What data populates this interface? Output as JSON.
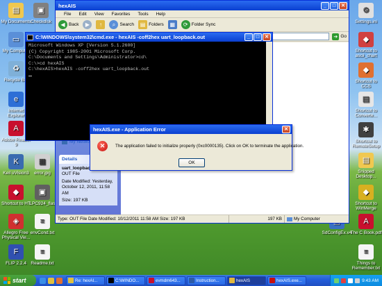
{
  "desktop_icons": {
    "my_documents": "My Documents",
    "checkdisk": "Checkdisk",
    "my_computer": "My Computer",
    "recycle_bin": "Recycle Bin",
    "internet_explorer": "Internet Explorer",
    "adobe_reader": "Adobe Reader 9",
    "keil": "Keil uVision3",
    "error_jpg": "error.jpg",
    "shortcut_ht": "Shortcut to HT",
    "lpc_flash": "LPC924_flas",
    "allegro": "Allegro Free Physical Vie...",
    "envcond": "envCond.txt",
    "flip": "FLIP 2.2.4",
    "readme": "Readme.txt",
    "settings": "Settings.ini",
    "shortcut_ascii": "Shortcut to ascii_chart",
    "shortcut_ccs": "Shortcut to CCS",
    "shortcut_convert": "Shortcut to Converte...",
    "shortcut_remote": "Shortcut to RemoteSetup",
    "snipped_desktop": "Snipped Desktop...",
    "shortcut_winmerge": "Shortcut to WinMerge",
    "sdconfig": "SdConfigEx.v4",
    "cbook": "The C Book.pdf",
    "things": "Things to Remember.txt"
  },
  "explorer": {
    "title": "hexAIS",
    "menu": [
      "File",
      "Edit",
      "View",
      "Favorites",
      "Tools",
      "Help"
    ],
    "toolbar": {
      "back": "Back",
      "search": "Search",
      "folders": "Folders",
      "folder_sync": "Folder Sync"
    },
    "address_go": "Go",
    "taskpane": {
      "network_link": "My Network",
      "details_head": "Details",
      "file_name": "uart_loopback.out",
      "file_type": "OUT File",
      "date_modified": "Date Modified: Yesterday, October 12, 2011, 11:58 AM",
      "size": "Size: 197 KB"
    },
    "status": {
      "info": "Type: OUT File Date Modified: 10/12/2011 11:58 AM Size: 197 KB",
      "size": "197 KB",
      "location": "My Computer"
    }
  },
  "console": {
    "title": "C:\\WINDOWS\\system32\\cmd.exe - hexAIS -coff2hex uart_loopback.out",
    "lines": [
      "Microsoft Windows XP [Version 5.1.2600]",
      "(C) Copyright 1985-2001 Microsoft Corp.",
      "",
      "C:\\Documents and Settings\\Administrator>cd\\",
      "",
      "C:\\>cd hexAIS",
      "",
      "C:\\hexAIS>hexAIS -coff2hex uart_loopback.out"
    ]
  },
  "error_dialog": {
    "title": "hexAIS.exe - Application Error",
    "message": "The application failed to initialize properly (0xc0000135). Click on OK to terminate the application.",
    "ok": "OK"
  },
  "taskbar": {
    "start": "start",
    "items": [
      "Re: hexAI...",
      "C:\\WINDO...",
      "evmdm643...",
      "Instruction...",
      "hexAIS",
      "hexAIS.exe..."
    ],
    "clock": "9:43 AM"
  }
}
